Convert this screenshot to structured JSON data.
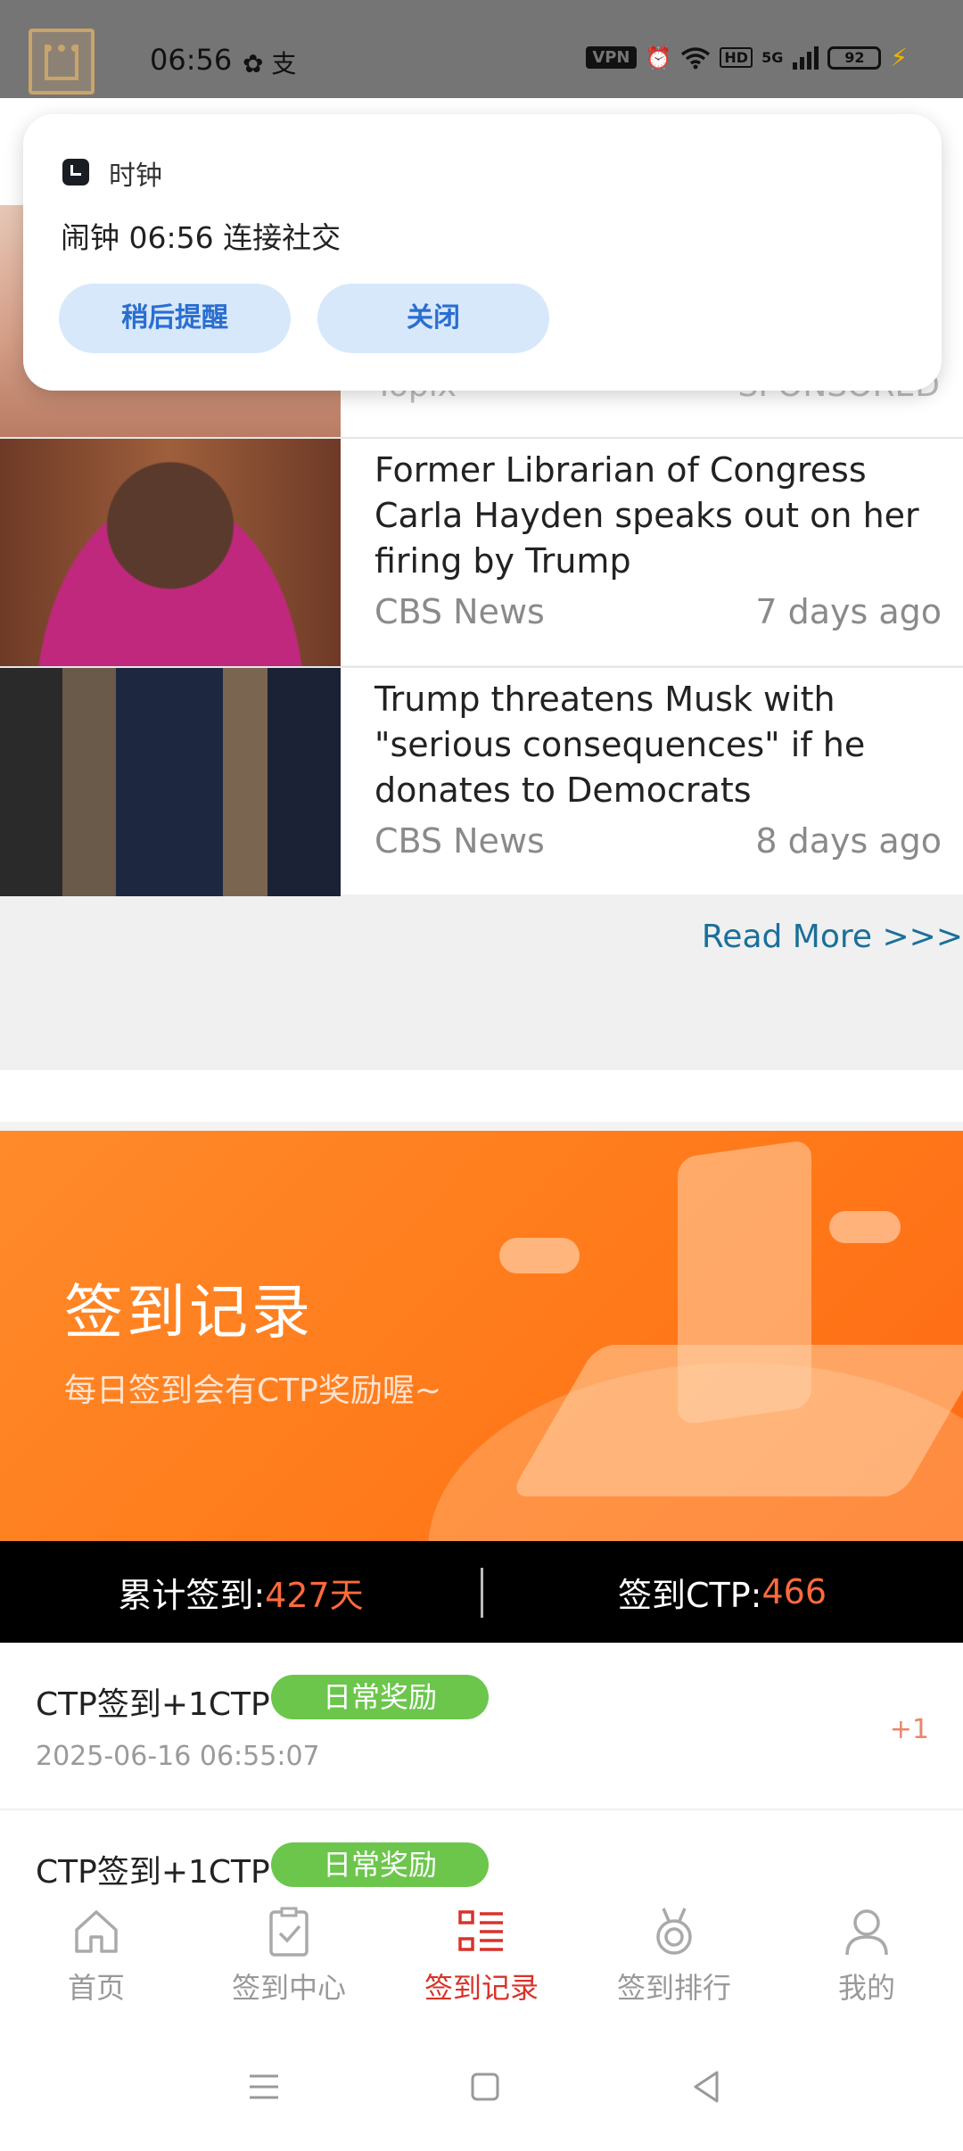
{
  "status_bar": {
    "time": "06:56",
    "left_icons": "✿ 支",
    "vpn": "VPN",
    "hd": "HD",
    "network": "5G",
    "battery": "92",
    "icons": [
      "app-logo-icon",
      "wechat-icon",
      "alipay-icon",
      "vpn-icon",
      "alarm-icon",
      "wifi-icon",
      "hd-icon",
      "signal-icon",
      "battery-icon",
      "charging-icon"
    ]
  },
  "notification": {
    "app_name": "时钟",
    "text": "闹钟 06:56 连接社交",
    "snooze_label": "稍后提醒",
    "close_label": "关闭"
  },
  "feed": {
    "partial_left": "Topix",
    "partial_right": "SPONSORED",
    "articles": [
      {
        "title": "Former Librarian of Congress Carla Hayden speaks out on her firing by Trump",
        "source": "CBS News",
        "time": "7 days ago"
      },
      {
        "title": "Trump threatens Musk with \"serious consequences\" if he donates to Democrats",
        "source": "CBS News",
        "time": "8 days ago"
      }
    ],
    "read_more": "Read More >>>"
  },
  "banner": {
    "title": "签到记录",
    "subtitle": "每日签到会有CTP奖励喔~"
  },
  "stats": {
    "total_label": "累计签到: ",
    "total_value": "427天",
    "ctp_label": "签到CTP: ",
    "ctp_value": "466"
  },
  "records": [
    {
      "title": "CTP签到+1CTP",
      "tag": "日常奖励",
      "date": "2025-06-16 06:55:07",
      "amount": "+1"
    },
    {
      "title": "CTP签到+1CTP",
      "tag": "日常奖励",
      "date": "",
      "amount": ""
    }
  ],
  "bottom_nav": {
    "items": [
      {
        "label": "首页",
        "icon": "home-icon"
      },
      {
        "label": "签到中心",
        "icon": "clipboard-check-icon"
      },
      {
        "label": "签到记录",
        "icon": "list-icon"
      },
      {
        "label": "签到排行",
        "icon": "medal-icon"
      },
      {
        "label": "我的",
        "icon": "user-icon"
      }
    ],
    "active_index": 2
  },
  "colors": {
    "accent_orange": "#ff7a1a",
    "active_red": "#d8332a",
    "tag_green": "#6cc64c",
    "stat_value": "#ff6a3c",
    "link_blue": "#1b6f9a"
  }
}
